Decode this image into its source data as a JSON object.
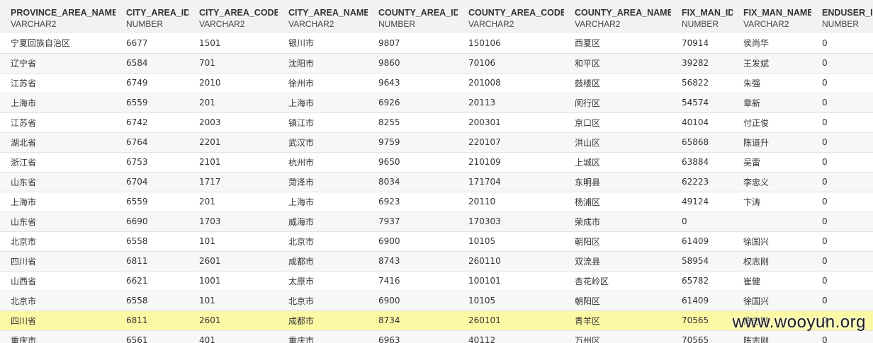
{
  "columns": [
    {
      "name": "PROVINCE_AREA_NAME",
      "type": "VARCHAR2"
    },
    {
      "name": "CITY_AREA_ID",
      "type": "NUMBER"
    },
    {
      "name": "CITY_AREA_CODE",
      "type": "VARCHAR2"
    },
    {
      "name": "CITY_AREA_NAME",
      "type": "VARCHAR2"
    },
    {
      "name": "COUNTY_AREA_ID",
      "type": "NUMBER"
    },
    {
      "name": "COUNTY_AREA_CODE",
      "type": "VARCHAR2"
    },
    {
      "name": "COUNTY_AREA_NAME",
      "type": "VARCHAR2"
    },
    {
      "name": "FIX_MAN_ID",
      "type": "NUMBER"
    },
    {
      "name": "FIX_MAN_NAME",
      "type": "VARCHAR2"
    },
    {
      "name": "ENDUSER_ID",
      "type": "NUMBER"
    }
  ],
  "rows": [
    [
      "宁夏回族自治区",
      "6677",
      "1501",
      "银川市",
      "9807",
      "150106",
      "西夏区",
      "70914",
      "侯尚华",
      "0"
    ],
    [
      "辽宁省",
      "6584",
      "701",
      "沈阳市",
      "9860",
      "70106",
      "和平区",
      "39282",
      "王发斌",
      "0"
    ],
    [
      "江苏省",
      "6749",
      "2010",
      "徐州市",
      "9643",
      "201008",
      "鼓楼区",
      "56822",
      "朱强",
      "0"
    ],
    [
      "上海市",
      "6559",
      "201",
      "上海市",
      "6926",
      "20113",
      "闵行区",
      "54574",
      "章新",
      "0"
    ],
    [
      "江苏省",
      "6742",
      "2003",
      "镇江市",
      "8255",
      "200301",
      "京口区",
      "40104",
      "付正俊",
      "0"
    ],
    [
      "湖北省",
      "6764",
      "2201",
      "武汉市",
      "9759",
      "220107",
      "洪山区",
      "65868",
      "陈道升",
      "0"
    ],
    [
      "浙江省",
      "6753",
      "2101",
      "杭州市",
      "9650",
      "210109",
      "上城区",
      "63884",
      "吴雷",
      "0"
    ],
    [
      "山东省",
      "6704",
      "1717",
      "菏泽市",
      "8034",
      "171704",
      "东明县",
      "62223",
      "李忠义",
      "0"
    ],
    [
      "上海市",
      "6559",
      "201",
      "上海市",
      "6923",
      "20110",
      "杨浦区",
      "49124",
      "卞涛",
      "0"
    ],
    [
      "山东省",
      "6690",
      "1703",
      "威海市",
      "7937",
      "170303",
      "荣成市",
      "0",
      "",
      "0"
    ],
    [
      "北京市",
      "6558",
      "101",
      "北京市",
      "6900",
      "10105",
      "朝阳区",
      "61409",
      "徐国兴",
      "0"
    ],
    [
      "四川省",
      "6811",
      "2601",
      "成都市",
      "8743",
      "260110",
      "双流县",
      "58954",
      "权志刚",
      "0"
    ],
    [
      "山西省",
      "6621",
      "1001",
      "太原市",
      "7416",
      "100101",
      "杏花岭区",
      "65782",
      "崔健",
      "0"
    ],
    [
      "北京市",
      "6558",
      "101",
      "北京市",
      "6900",
      "10105",
      "朝阳区",
      "61409",
      "徐国兴",
      "0"
    ],
    [
      "四川省",
      "6811",
      "2601",
      "成都市",
      "8734",
      "260101",
      "青羊区",
      "70565",
      "陈志刚",
      "0"
    ],
    [
      "重庆市",
      "6561",
      "401",
      "重庆市",
      "6963",
      "40112",
      "万州区",
      "70565",
      "陈志刚",
      "0"
    ]
  ],
  "selected_row": 14,
  "watermark": "www.wooyun.org",
  "colors": {
    "header_bg": "#f2f2f2",
    "row_alt": "#f7f7f7",
    "selected": "#fcf9a5"
  }
}
